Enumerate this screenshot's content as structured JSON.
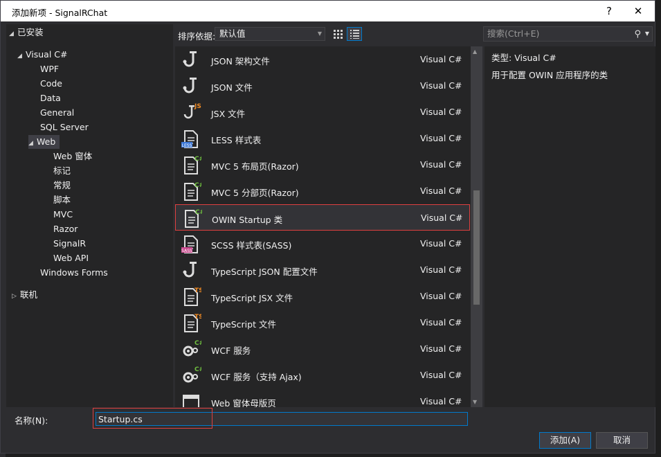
{
  "window": {
    "title": "添加新项 - SignalRChat",
    "help_label": "?",
    "close_label": "✕"
  },
  "tree": {
    "installed": "已安装",
    "visual_csharp": "Visual C#",
    "wpf": "WPF",
    "code": "Code",
    "data": "Data",
    "general": "General",
    "sql_server": "SQL Server",
    "web": "Web",
    "web_form": "Web 窗体",
    "markup": "标记",
    "regular": "常规",
    "script": "脚本",
    "mvc": "MVC",
    "razor": "Razor",
    "signalr": "SignalR",
    "web_api": "Web API",
    "windows_forms": "Windows Forms",
    "online": "联机"
  },
  "toolbar": {
    "sort_label": "排序依据:",
    "sort_value": "默认值"
  },
  "search": {
    "placeholder": "搜索(Ctrl+E)"
  },
  "templates": [
    {
      "name": "JSON 架构文件",
      "type": "Visual C#",
      "icon": "json-file-icon",
      "badge": ""
    },
    {
      "name": "JSON 文件",
      "type": "Visual C#",
      "icon": "json-file-icon",
      "badge": ""
    },
    {
      "name": "JSX 文件",
      "type": "Visual C#",
      "icon": "jsx-file-icon",
      "badge": "JS"
    },
    {
      "name": "LESS 样式表",
      "type": "Visual C#",
      "icon": "less-file-icon",
      "badge": "LESS"
    },
    {
      "name": "MVC 5 布局页(Razor)",
      "type": "Visual C#",
      "icon": "razor-layout-icon",
      "badge": "C#"
    },
    {
      "name": "MVC 5 分部页(Razor)",
      "type": "Visual C#",
      "icon": "razor-partial-icon",
      "badge": "C#"
    },
    {
      "name": "OWIN Startup 类",
      "type": "Visual C#",
      "icon": "owin-startup-icon",
      "badge": "C#"
    },
    {
      "name": "SCSS 样式表(SASS)",
      "type": "Visual C#",
      "icon": "scss-file-icon",
      "badge": "SASS"
    },
    {
      "name": "TypeScript JSON 配置文件",
      "type": "Visual C#",
      "icon": "json-file-icon",
      "badge": ""
    },
    {
      "name": "TypeScript JSX 文件",
      "type": "Visual C#",
      "icon": "tsx-file-icon",
      "badge": "TS"
    },
    {
      "name": "TypeScript 文件",
      "type": "Visual C#",
      "icon": "ts-file-icon",
      "badge": "TS"
    },
    {
      "name": "WCF 服务",
      "type": "Visual C#",
      "icon": "wcf-service-icon",
      "badge": "C#"
    },
    {
      "name": "WCF 服务（支持 Ajax)",
      "type": "Visual C#",
      "icon": "wcf-ajax-icon",
      "badge": "C#"
    },
    {
      "name": "Web 窗体母版页",
      "type": "Visual C#",
      "icon": "master-page-icon",
      "badge": ""
    }
  ],
  "selected_index": 6,
  "details": {
    "type_label": "类型:",
    "type_value": "Visual C#",
    "description": "用于配置 OWIN 应用程序的类"
  },
  "name_field": {
    "label": "名称(N):",
    "value": "Startup.cs"
  },
  "buttons": {
    "add": "添加(A)",
    "cancel": "取消"
  },
  "colors": {
    "accent": "#007acc",
    "highlight": "#e04040",
    "badge_green": "#6fbf3f",
    "badge_orange": "#f08a24",
    "badge_blue": "#3c78d8",
    "badge_pink": "#c8468c"
  }
}
